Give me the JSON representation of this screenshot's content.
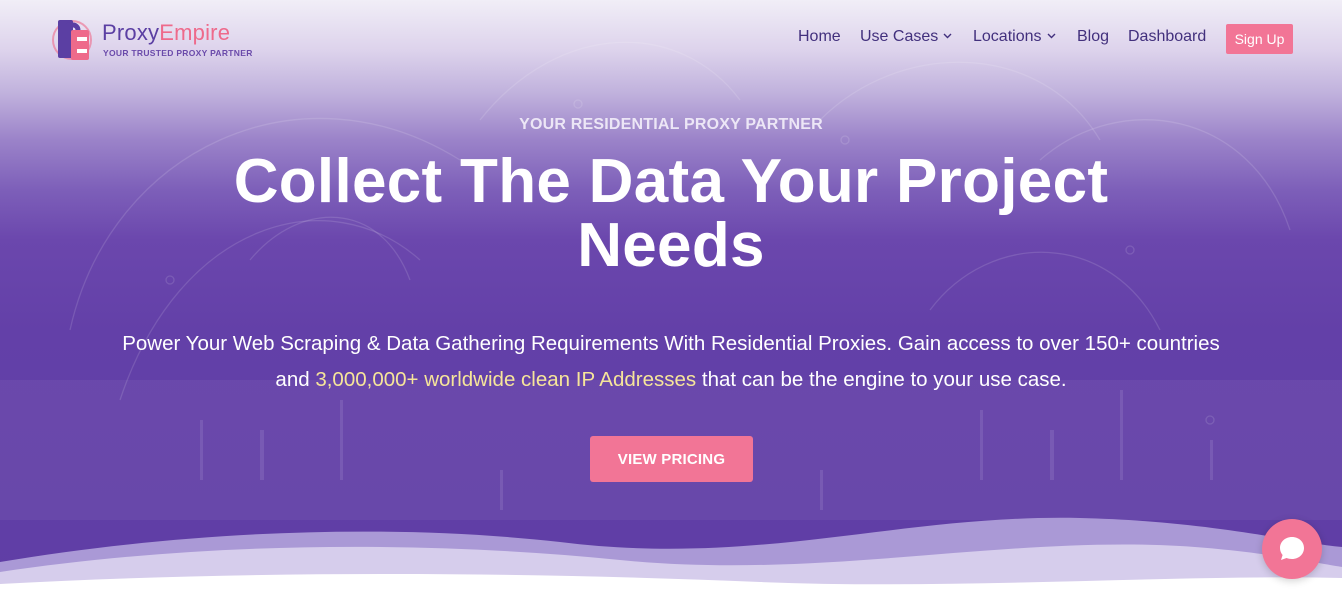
{
  "brand": {
    "name_part1": "Proxy",
    "name_part2": "Empire",
    "tagline": "YOUR TRUSTED PROXY PARTNER"
  },
  "nav": {
    "items": [
      {
        "label": "Home",
        "has_dropdown": false
      },
      {
        "label": "Use Cases",
        "has_dropdown": true
      },
      {
        "label": "Locations",
        "has_dropdown": true
      },
      {
        "label": "Blog",
        "has_dropdown": false
      },
      {
        "label": "Dashboard",
        "has_dropdown": false
      }
    ],
    "signup_label": "Sign Up"
  },
  "hero": {
    "eyebrow": "YOUR RESIDENTIAL PROXY PARTNER",
    "headline": "Collect The Data Your Project Needs",
    "subtext_part1": "Power Your Web Scraping & Data Gathering Requirements With Residential Proxies. Gain access to over 150+ countries and ",
    "subtext_highlight": "3,000,000+ worldwide clean IP Addresses",
    "subtext_part2": " that can be the engine to your use case.",
    "cta_label": "VIEW PRICING"
  },
  "chat_widget": {
    "icon": "chat-bubble-icon"
  },
  "colors": {
    "accent_pink": "#f27596",
    "brand_purple": "#5b3fa3",
    "nav_text": "#42307d",
    "highlight_yellow": "#f6e59a",
    "hero_purple": "#6340a8"
  }
}
